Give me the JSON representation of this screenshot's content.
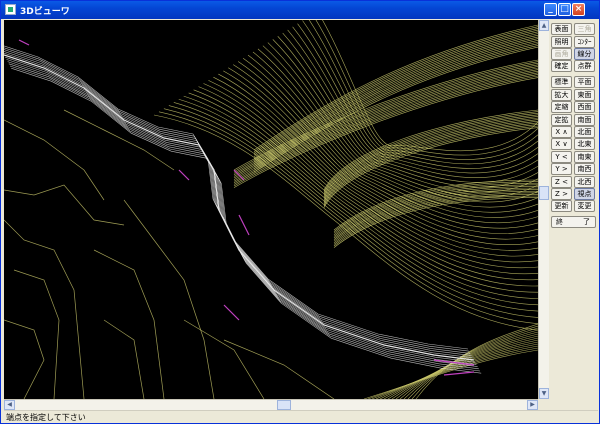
{
  "window": {
    "title": "3Dビューワ",
    "minimize_icon": "minimize-icon",
    "maximize_icon": "maximize-icon",
    "close_icon": "close-icon"
  },
  "toolbar": {
    "rows": [
      [
        {
          "label": "表面",
          "enabled": true
        },
        {
          "label": "三角",
          "enabled": false
        }
      ],
      [
        {
          "label": "照明",
          "enabled": true
        },
        {
          "label": "ｺﾝﾀｰ",
          "enabled": true
        }
      ],
      [
        {
          "label": "画角",
          "enabled": false
        },
        {
          "label": "線分",
          "enabled": true,
          "pressed": true
        }
      ],
      [
        {
          "label": "確定",
          "enabled": true
        },
        {
          "label": "点群",
          "enabled": true
        }
      ],
      [
        {
          "label": "標準",
          "enabled": true
        },
        {
          "label": "平面",
          "enabled": true
        }
      ],
      [
        {
          "label": "拡大",
          "enabled": true
        },
        {
          "label": "東面",
          "enabled": true
        }
      ],
      [
        {
          "label": "定縮",
          "enabled": true
        },
        {
          "label": "西面",
          "enabled": true
        }
      ],
      [
        {
          "label": "定拡",
          "enabled": true
        },
        {
          "label": "南面",
          "enabled": true
        }
      ],
      [
        {
          "label": "X ∧",
          "enabled": true
        },
        {
          "label": "北面",
          "enabled": true
        }
      ],
      [
        {
          "label": "X ∨",
          "enabled": true
        },
        {
          "label": "北東",
          "enabled": true
        }
      ],
      [
        {
          "label": "Y <",
          "enabled": true
        },
        {
          "label": "南東",
          "enabled": true
        }
      ],
      [
        {
          "label": "Y >",
          "enabled": true
        },
        {
          "label": "南西",
          "enabled": true
        }
      ],
      [
        {
          "label": "Z <",
          "enabled": true
        },
        {
          "label": "北西",
          "enabled": true
        }
      ],
      [
        {
          "label": "Z >",
          "enabled": true
        },
        {
          "label": "視点",
          "enabled": true,
          "pressed": true
        }
      ],
      [
        {
          "label": "更新",
          "enabled": true
        },
        {
          "label": "変更",
          "enabled": true
        }
      ]
    ],
    "exit_label_left": "終",
    "exit_label_right": "了"
  },
  "status_bar": {
    "message": "端点を指定して下さい"
  },
  "colors": {
    "contour": "#c8c66a",
    "road": "#e6e6e6",
    "boundary": "#c040c0",
    "background": "#000000"
  }
}
